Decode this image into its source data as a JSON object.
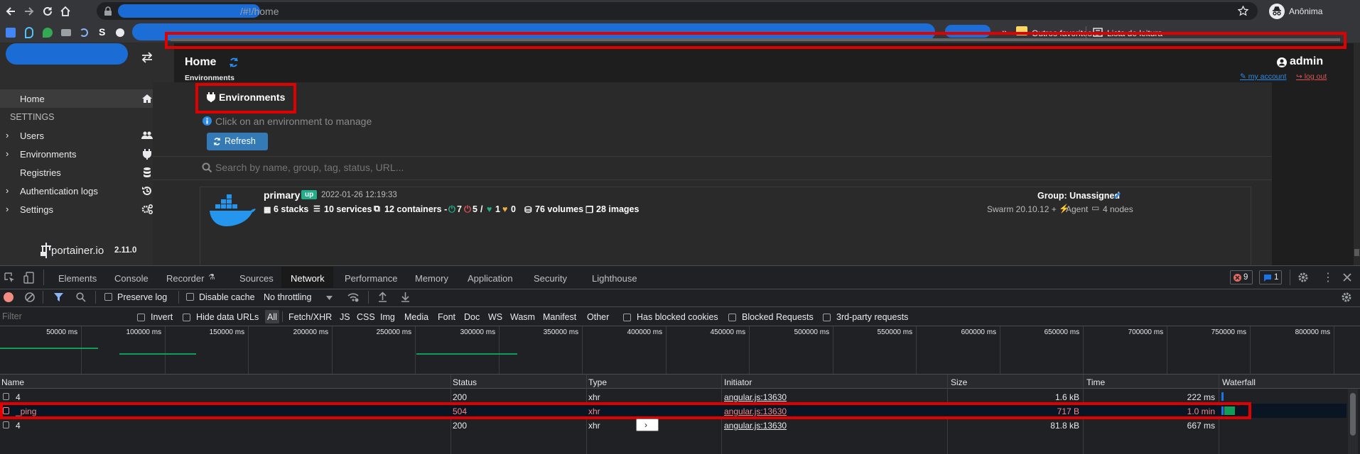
{
  "browser": {
    "url": "/#!/home",
    "profile": "Anônima",
    "bookmarks": {
      "others": "Outros favoritos",
      "reading_list": "Lista de leitura",
      "more": "»"
    }
  },
  "sidebar": {
    "items": [
      {
        "label": "Home",
        "icon": "home-icon"
      },
      {
        "label": "Users",
        "icon": "users-icon"
      },
      {
        "label": "Environments",
        "icon": "plug-icon"
      },
      {
        "label": "Registries",
        "icon": "database-icon"
      },
      {
        "label": "Authentication logs",
        "icon": "history-icon"
      },
      {
        "label": "Settings",
        "icon": "cogs-icon"
      }
    ],
    "settings_header": "SETTINGS",
    "footer": {
      "brand": "portainer.io",
      "version": "2.11.0"
    }
  },
  "header": {
    "title": "Home",
    "breadcrumb": "Environments",
    "user": "admin",
    "my_account": "my account",
    "log_out": "log out"
  },
  "environments": {
    "title": "Environments",
    "hint": "Click on an environment to manage",
    "refresh": "Refresh",
    "search_placeholder": "Search by name, group, tag, status, URL...",
    "env": {
      "name": "primary",
      "status": "up",
      "timestamp": "2022-01-26 12:19:33",
      "group": "Group: Unassigned",
      "stacks": "6 stacks",
      "services": "10 services",
      "containers": "12 containers -",
      "healthy": "7",
      "stopped": "5",
      "slash": "/",
      "heart": "1",
      "unhealthy": "0",
      "volumes": "76 volumes",
      "images": "28 images",
      "swarm": "Swarm 20.10.12 +",
      "agent": "Agent",
      "nodes": "4 nodes"
    }
  },
  "devtools": {
    "tabs": [
      "Elements",
      "Console",
      "Recorder",
      "Sources",
      "Network",
      "Performance",
      "Memory",
      "Application",
      "Security",
      "Lighthouse"
    ],
    "active_tab": "Network",
    "errors": "9",
    "messages": "1",
    "toolbar": {
      "preserve_log": "Preserve log",
      "disable_cache": "Disable cache",
      "throttling": "No throttling"
    },
    "filter": {
      "placeholder": "Filter",
      "invert": "Invert",
      "hide_data_urls": "Hide data URLs",
      "types": [
        "All",
        "Fetch/XHR",
        "JS",
        "CSS",
        "Img",
        "Media",
        "Font",
        "Doc",
        "WS",
        "Wasm",
        "Manifest",
        "Other"
      ],
      "has_blocked_cookies": "Has blocked cookies",
      "blocked_requests": "Blocked Requests",
      "third_party": "3rd-party requests"
    },
    "timeline_ticks": [
      "50000 ms",
      "100000 ms",
      "150000 ms",
      "200000 ms",
      "250000 ms",
      "300000 ms",
      "350000 ms",
      "400000 ms",
      "450000 ms",
      "500000 ms",
      "550000 ms",
      "600000 ms",
      "650000 ms",
      "700000 ms",
      "750000 ms",
      "800000 ms"
    ],
    "columns": [
      "Name",
      "Status",
      "Type",
      "Initiator",
      "Size",
      "Time",
      "Waterfall"
    ],
    "rows": [
      {
        "name": "4",
        "status": "200",
        "type": "xhr",
        "initiator": "angular.js:13630",
        "size": "1.6 kB",
        "time": "222 ms"
      },
      {
        "name": "_ping",
        "status": "504",
        "type": "xhr",
        "initiator": "angular.js:13630",
        "size": "717 B",
        "time": "1.0 min"
      },
      {
        "name": "4",
        "status": "200",
        "type": "xhr",
        "initiator": "angular.js:13630",
        "size": "81.8 kB",
        "time": "667 ms"
      }
    ],
    "colors": {
      "error": "#f28b82",
      "active_bg": "#1a1a1a",
      "link": "#8ab4f8"
    }
  }
}
